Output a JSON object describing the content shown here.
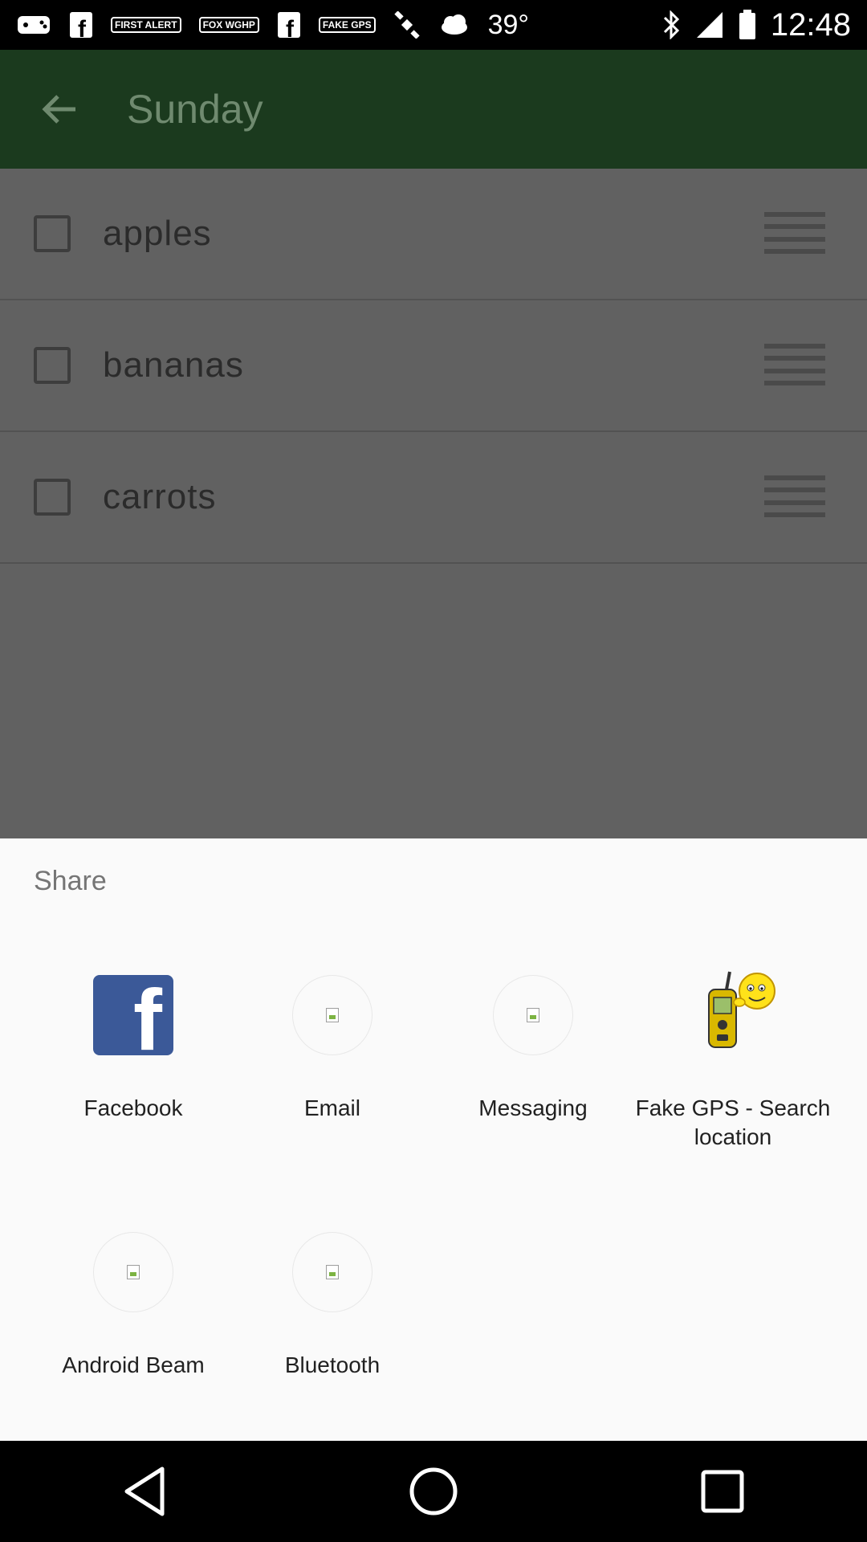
{
  "status_bar": {
    "badges": [
      "FIRST ALERT",
      "FOX WGHP",
      "FAKE GPS"
    ],
    "temperature": "39°",
    "time": "12:48"
  },
  "app_bar": {
    "title": "Sunday"
  },
  "list": {
    "items": [
      {
        "label": "apples"
      },
      {
        "label": "bananas"
      },
      {
        "label": "carrots"
      }
    ]
  },
  "share_sheet": {
    "title": "Share",
    "apps": [
      {
        "label": "Facebook",
        "icon": "facebook-icon"
      },
      {
        "label": "Email",
        "icon": "email-icon"
      },
      {
        "label": "Messaging",
        "icon": "messaging-icon"
      },
      {
        "label": "Fake GPS - Search location",
        "icon": "fake-gps-icon"
      },
      {
        "label": "Android Beam",
        "icon": "android-beam-icon"
      },
      {
        "label": "Bluetooth",
        "icon": "bluetooth-icon"
      }
    ]
  },
  "colors": {
    "app_bar": "#1b3a1e",
    "dim_overlay": "#616161",
    "facebook_blue": "#3b5998",
    "sheet_bg": "#fafafa"
  }
}
